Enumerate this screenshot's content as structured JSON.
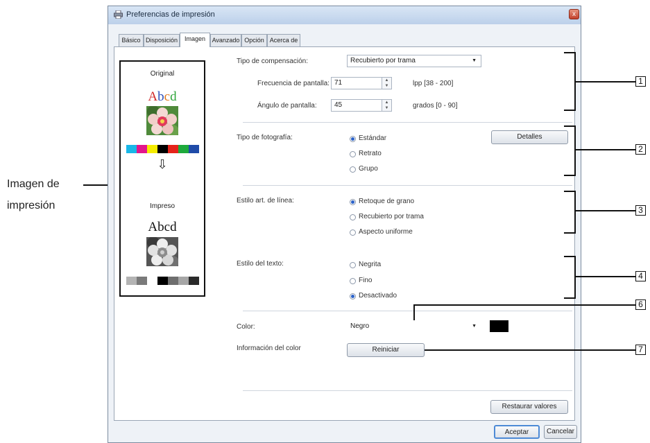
{
  "window": {
    "title": "Preferencias de impresión",
    "close": "x"
  },
  "tabs": [
    "Básico",
    "Disposición",
    "Imagen",
    "Avanzado",
    "Opción",
    "Acerca de"
  ],
  "preview": {
    "original_label": "Original",
    "original_sample": "Abcd",
    "arrow": "⇩",
    "printed_label": "Impreso",
    "printed_sample": "Abcd",
    "original_swatches": [
      "#19b7e8",
      "#e3168c",
      "#f5ec00",
      "#000000",
      "#e5231b",
      "#1eaa3c",
      "#1f4ba8"
    ],
    "printed_swatches": [
      "#b4b4b4",
      "#7a7a7a",
      "#ffffff",
      "#000000",
      "#6e6e6e",
      "#a6a6a6",
      "#2a2a2a"
    ]
  },
  "compensation": {
    "label": "Tipo de compensación:",
    "value": "Recubierto por trama",
    "frequency_label": "Frecuencia de pantalla:",
    "frequency_value": "71",
    "frequency_range": "lpp [38 - 200]",
    "angle_label": "Ángulo de pantalla:",
    "angle_value": "45",
    "angle_range": "grados [0 - 90]"
  },
  "photo": {
    "label": "Tipo de fotografía:",
    "options": [
      "Estándar",
      "Retrato",
      "Grupo"
    ],
    "selected": 0,
    "details_button": "Detalles"
  },
  "line_art": {
    "label": "Estilo art. de línea:",
    "options": [
      "Retoque de grano",
      "Recubierto por trama",
      "Aspecto uniforme"
    ],
    "selected": 0
  },
  "text_style": {
    "label": "Estilo del texto:",
    "options": [
      "Negrita",
      "Fino",
      "Desactivado"
    ],
    "selected": 2
  },
  "color": {
    "label": "Color:",
    "value": "Negro",
    "swatch": "#000000"
  },
  "color_info": {
    "label": "Información del color",
    "reset_button": "Reiniciar"
  },
  "restore_button": "Restaurar valores",
  "ok_button": "Aceptar",
  "cancel_button": "Cancelar",
  "callouts": {
    "image_label_line1": "Imagen de",
    "image_label_line2": "impresión",
    "numbers": [
      "1",
      "2",
      "3",
      "4",
      "6",
      "7"
    ]
  }
}
